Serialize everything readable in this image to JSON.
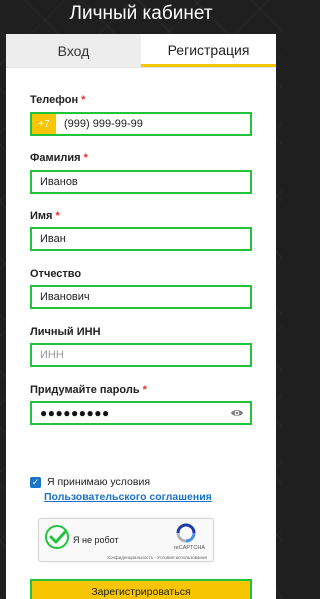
{
  "page": {
    "title": "Личный кабинет"
  },
  "tabs": [
    {
      "label": "Вход",
      "active": false
    },
    {
      "label": "Регистрация",
      "active": true
    }
  ],
  "form": {
    "phone": {
      "label": "Телефон",
      "required": "*",
      "prefix": "+7",
      "value": "(999) 999-99-99"
    },
    "last_name": {
      "label": "Фамилия",
      "required": "*",
      "value": "Иванов"
    },
    "first_name": {
      "label": "Имя",
      "required": "*",
      "value": "Иван"
    },
    "patronymic": {
      "label": "Отчество",
      "value": "Иванович"
    },
    "inn": {
      "label": "Личный ИНН",
      "placeholder": "ИНН"
    },
    "password": {
      "label": "Придумайте пароль",
      "required": "*",
      "value": "●●●●●●●●●",
      "icon": "eye-icon"
    },
    "agreement": {
      "checked": true,
      "label": "Я принимаю условия",
      "link": "Пользовательского соглашения"
    },
    "recaptcha": {
      "label": "Я не робот",
      "brand": "reCAPTCHA",
      "links": "Конфиденциальность - Условия использования"
    },
    "submit_label": "Зарегистрироваться"
  },
  "colors": {
    "accent": "#f7c600",
    "highlight": "#21c43a",
    "link": "#1a73c8",
    "required": "#e2312c"
  }
}
